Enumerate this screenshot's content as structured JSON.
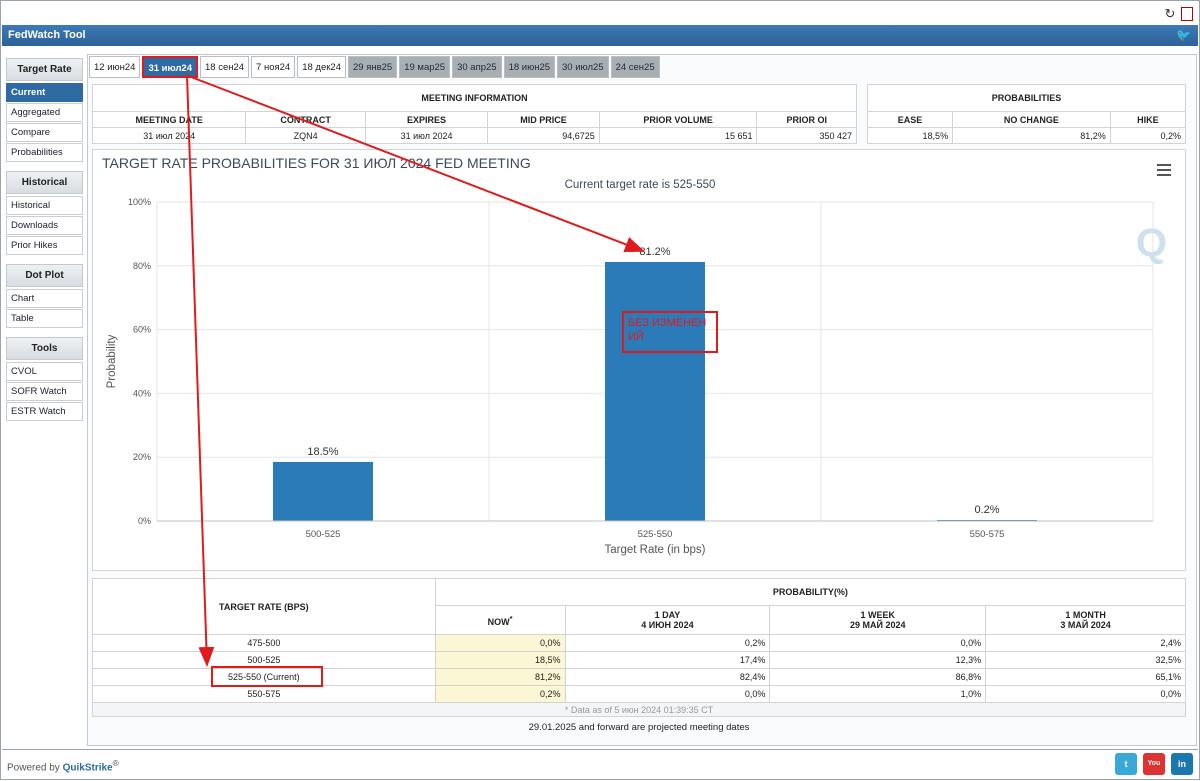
{
  "app": {
    "title": "FedWatch Tool"
  },
  "tabs": [
    "12 июн24",
    "31 июл24",
    "18 сен24",
    "7 ноя24",
    "18 дек24",
    "29 янв25",
    "19 мар25",
    "30 апр25",
    "18 июн25",
    "30 июл25",
    "24 сен25"
  ],
  "sidebar": {
    "groups": [
      {
        "head": "Target Rate",
        "items": [
          "Current",
          "Aggregated",
          "Compare",
          "Probabilities"
        ]
      },
      {
        "head": "Historical",
        "items": [
          "Historical",
          "Downloads",
          "Prior Hikes"
        ]
      },
      {
        "head": "Dot Plot",
        "items": [
          "Chart",
          "Table"
        ]
      },
      {
        "head": "Tools",
        "items": [
          "CVOL",
          "SOFR Watch",
          "ESTR Watch"
        ]
      }
    ]
  },
  "meeting": {
    "caption": "MEETING INFORMATION",
    "headers": [
      "MEETING DATE",
      "CONTRACT",
      "EXPIRES",
      "MID PRICE",
      "PRIOR VOLUME",
      "PRIOR OI"
    ],
    "values": [
      "31 июл 2024",
      "ZQN4",
      "31 июл 2024",
      "94,6725",
      "15 651",
      "350 427"
    ]
  },
  "probabilities": {
    "caption": "PROBABILITIES",
    "headers": [
      "EASE",
      "NO CHANGE",
      "HIKE"
    ],
    "values": [
      "18,5%",
      "81,2%",
      "0,2%"
    ]
  },
  "chart_data": {
    "type": "bar",
    "title": "TARGET RATE PROBABILITIES FOR 31 ИЮЛ 2024 FED MEETING",
    "subtitle": "Current target rate is 525-550",
    "categories": [
      "500-525",
      "525-550",
      "550-575"
    ],
    "values": [
      18.5,
      81.2,
      0.2
    ],
    "value_labels": [
      "18.5%",
      "81.2%",
      "0.2%"
    ],
    "xlabel": "Target Rate (in bps)",
    "ylabel": "Probability",
    "ylim": [
      0,
      100
    ],
    "yticks": [
      0,
      20,
      40,
      60,
      80,
      100
    ],
    "ytick_labels": [
      "0%",
      "20%",
      "40%",
      "60%",
      "80%",
      "100%"
    ],
    "bar_color": "#2b7bb9",
    "grid": true
  },
  "annotation": {
    "text": "БЕЗ ИЗМЕНЕНИЙ",
    "color": "#e01b1b"
  },
  "logo_letter": "Q",
  "bottom": {
    "col_rate": "TARGET RATE (BPS)",
    "col_prob": "PROBABILITY(%)",
    "now": "NOW",
    "now_mark": "*",
    "day1": "1 DAY",
    "day1_date": "4 ИЮН 2024",
    "week1": "1 WEEK",
    "week1_date": "29 МАЙ 2024",
    "month1": "1 MONTH",
    "month1_date": "3 МАЙ 2024",
    "rows": [
      {
        "rate": "475-500",
        "now": "0,0%",
        "d1": "0,2%",
        "w1": "0,0%",
        "m1": "2,4%"
      },
      {
        "rate": "500-525",
        "now": "18,5%",
        "d1": "17,4%",
        "w1": "12,3%",
        "m1": "32,5%"
      },
      {
        "rate": "525-550 (Current)",
        "now": "81,2%",
        "d1": "82,4%",
        "w1": "86,8%",
        "m1": "65,1%"
      },
      {
        "rate": "550-575",
        "now": "0,2%",
        "d1": "0,0%",
        "w1": "1,0%",
        "m1": "0,0%"
      }
    ],
    "note": "* Data as of 5 июн 2024 01:39:35 CT",
    "projected": "29.01.2025 and forward are projected meeting dates"
  },
  "footer": {
    "powered": "Powered by",
    "brand": "QuikStrike",
    "reg": "®"
  },
  "social": [
    "twitter",
    "YouTube",
    "in"
  ],
  "accent": "#2f6aa5",
  "annotation_color": "#e01b1b"
}
